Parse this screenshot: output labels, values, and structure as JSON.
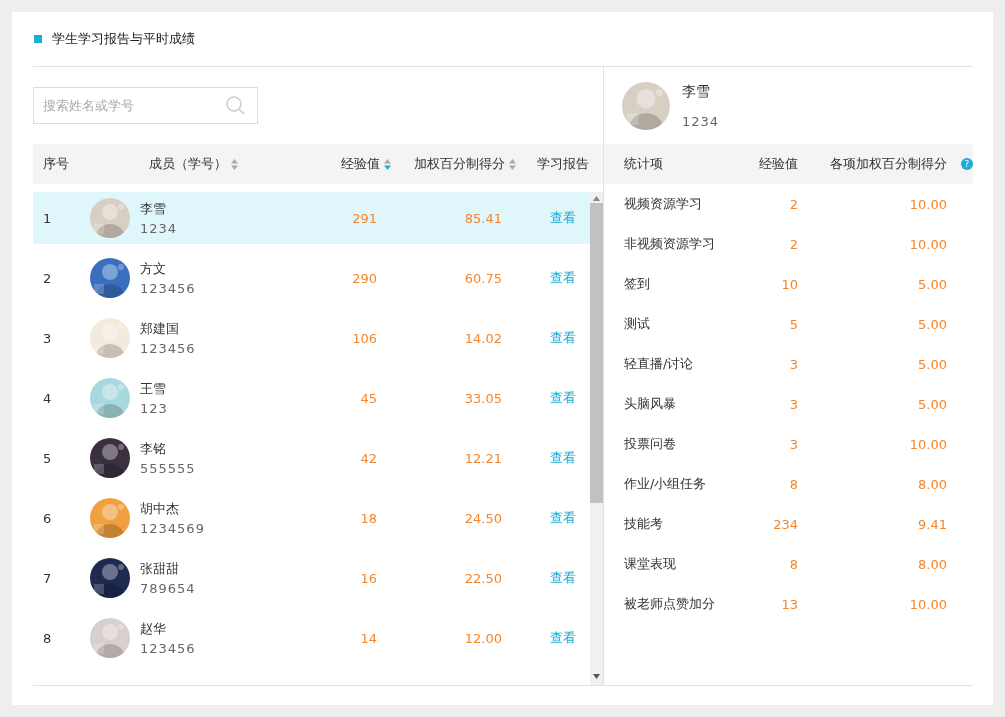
{
  "title": "学生学习报告与平时成绩",
  "search": {
    "placeholder": "搜索姓名或学号"
  },
  "members_table": {
    "columns": [
      {
        "label": "序号",
        "sortable": false
      },
      {
        "label": "成员（学号）",
        "sortable": true,
        "sorted": false
      },
      {
        "label": "经验值",
        "sortable": true,
        "sorted": true
      },
      {
        "label": "加权百分制得分",
        "sortable": true,
        "sorted": false
      },
      {
        "label": "学习报告",
        "sortable": false
      }
    ],
    "rows": [
      {
        "index": "1",
        "name": "李雪",
        "id": "1234",
        "exp": "291",
        "score": "85.41",
        "report": "查看",
        "selected": true
      },
      {
        "index": "2",
        "name": "方文",
        "id": "123456",
        "exp": "290",
        "score": "60.75",
        "report": "查看",
        "selected": false
      },
      {
        "index": "3",
        "name": "郑建国",
        "id": "123456",
        "exp": "106",
        "score": "14.02",
        "report": "查看",
        "selected": false
      },
      {
        "index": "4",
        "name": "王雪",
        "id": "123",
        "exp": "45",
        "score": "33.05",
        "report": "查看",
        "selected": false
      },
      {
        "index": "5",
        "name": "李铭",
        "id": "555555",
        "exp": "42",
        "score": "12.21",
        "report": "查看",
        "selected": false
      },
      {
        "index": "6",
        "name": "胡中杰",
        "id": "1234569",
        "exp": "18",
        "score": "24.50",
        "report": "查看",
        "selected": false
      },
      {
        "index": "7",
        "name": "张甜甜",
        "id": "789654",
        "exp": "16",
        "score": "22.50",
        "report": "查看",
        "selected": false
      },
      {
        "index": "8",
        "name": "赵华",
        "id": "123456",
        "exp": "14",
        "score": "12.00",
        "report": "查看",
        "selected": false
      }
    ]
  },
  "detail": {
    "name": "李雪",
    "id": "1234",
    "columns": [
      {
        "label": "统计项"
      },
      {
        "label": "经验值"
      },
      {
        "label": "各项加权百分制得分",
        "help": "?"
      }
    ],
    "rows": [
      {
        "item": "视频资源学习",
        "exp": "2",
        "score": "10.00"
      },
      {
        "item": "非视频资源学习",
        "exp": "2",
        "score": "10.00"
      },
      {
        "item": "签到",
        "exp": "10",
        "score": "5.00"
      },
      {
        "item": "测试",
        "exp": "5",
        "score": "5.00"
      },
      {
        "item": "轻直播/讨论",
        "exp": "3",
        "score": "5.00"
      },
      {
        "item": "头脑风暴",
        "exp": "3",
        "score": "5.00"
      },
      {
        "item": "投票问卷",
        "exp": "3",
        "score": "10.00"
      },
      {
        "item": "作业/小组任务",
        "exp": "8",
        "score": "8.00"
      },
      {
        "item": "技能考",
        "exp": "234",
        "score": "9.41"
      },
      {
        "item": "课堂表现",
        "exp": "8",
        "score": "8.00"
      },
      {
        "item": "被老师点赞加分",
        "exp": "13",
        "score": "10.00"
      }
    ]
  }
}
